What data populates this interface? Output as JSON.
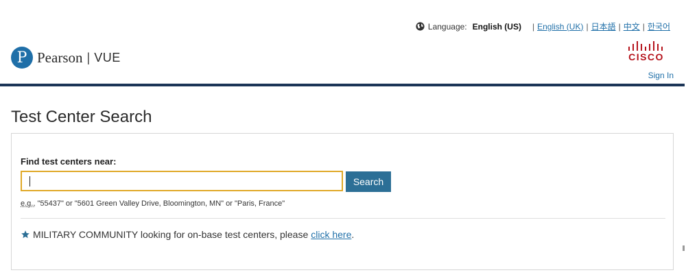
{
  "header": {
    "language_label": "Language:",
    "current_language": "English (US)",
    "language_links": [
      "English (UK)",
      "日本語",
      "中文",
      "한국어"
    ],
    "separator": "|",
    "logo_name": "Pearson",
    "logo_divider": "|",
    "logo_sub": "VUE",
    "partner_logo_text": "CISCO",
    "sign_in": "Sign In",
    "globe_icon": "globe-icon"
  },
  "main": {
    "page_title": "Test Center Search",
    "find_label": "Find test centers near:",
    "search_input_value": "",
    "search_button": "Search",
    "example_prefix": "e.g.,",
    "example_text": " \"55437\" or \"5601 Green Valley Drive, Bloomington, MN\" or \"Paris, France\"",
    "military_text": "MILITARY COMMUNITY looking for on-base test centers, please",
    "military_link": "click here",
    "military_suffix": ".",
    "star_icon": "star-icon"
  },
  "colors": {
    "brand_blue": "#1f6fa8",
    "navy_rule": "#1c3557",
    "button_blue": "#2c6f96",
    "input_focus": "#e0a826",
    "cisco_red": "#b5121b"
  }
}
